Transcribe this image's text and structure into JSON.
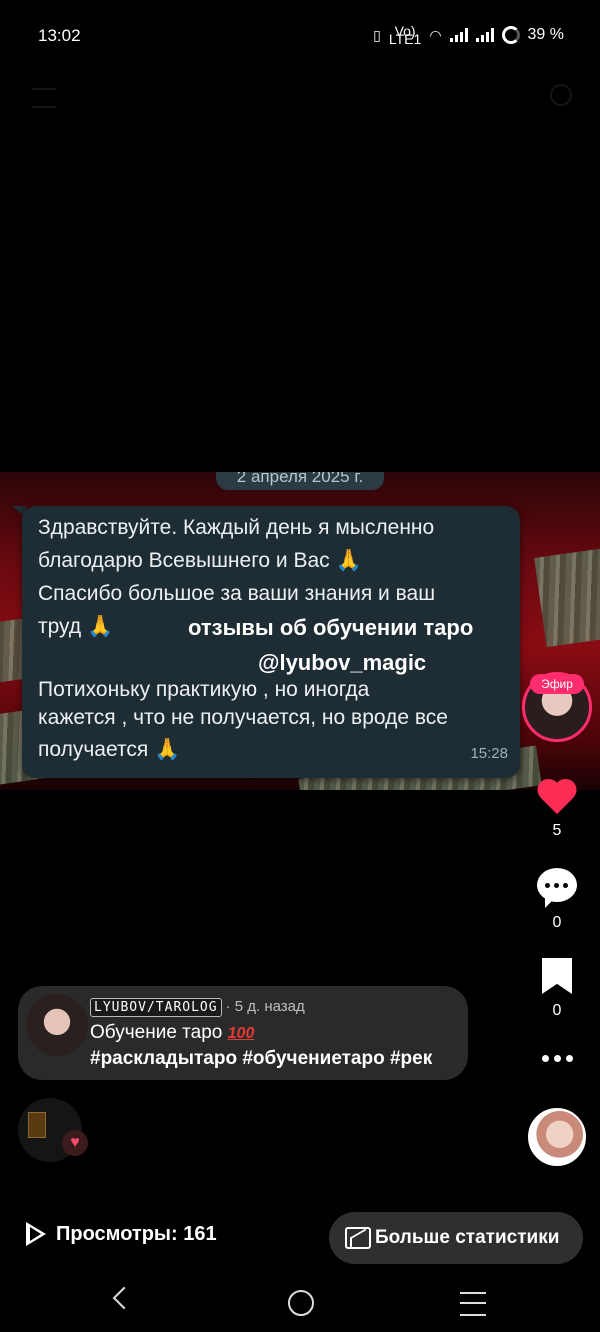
{
  "status_bar": {
    "time": "13:02",
    "volte": "Vo)\nLTE1",
    "battery": "39 %"
  },
  "video": {
    "date_label": "2 апреля 2025 г.",
    "message_lines": [
      "Здравствуйте. Каждый день я мысленно",
      "благодарю Всевышнего и Вас 🙏",
      "Спасибо большое за ваши знания и ваш",
      "труд 🙏",
      "Потихоньку практикую , но иногда",
      "кажется , что не получается, но вроде все",
      "получается 🙏"
    ],
    "overlay_line1": "отзывы об обучении таро",
    "overlay_line2": "@lyubov_magic",
    "message_time": "15:28"
  },
  "live": {
    "badge": "Эфир"
  },
  "actions": {
    "likes": "5",
    "comments": "0",
    "saves": "0"
  },
  "caption": {
    "author": "LYUBOV/TAROLOG",
    "time_ago": "· 5 д. назад",
    "title": "Обучение таро",
    "title_emoji": "100",
    "tags": "#раскладытаро #обучениетаро #рек"
  },
  "footer": {
    "views": "Просмотры: 161",
    "stats_button": "Больше статистики"
  },
  "colors": {
    "like": "#ff2d55",
    "live_ring": "#ff2d6e",
    "bubble": "#1e2c33"
  }
}
